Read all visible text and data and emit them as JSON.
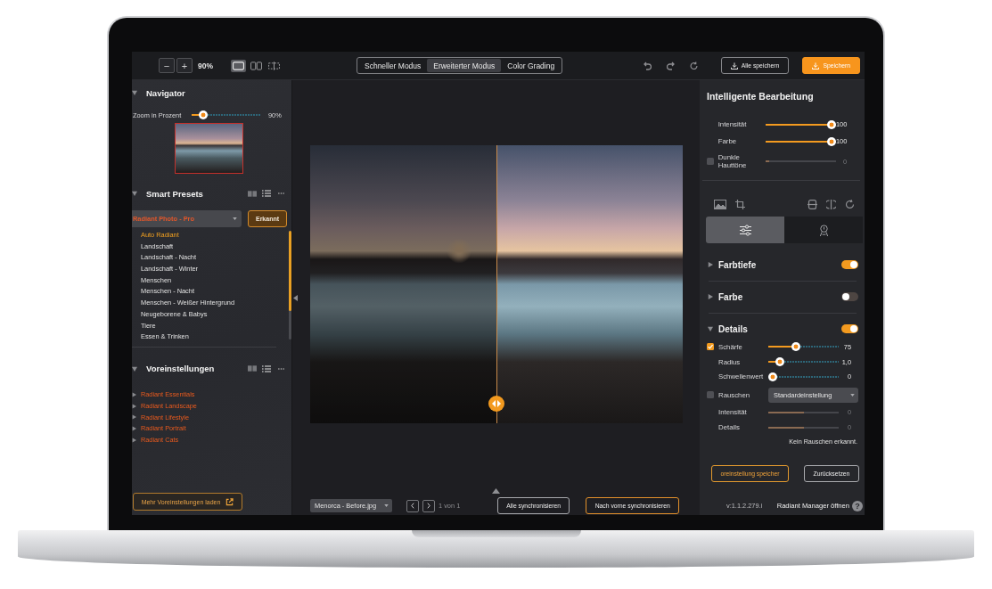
{
  "toolbar": {
    "zoom_out": "−",
    "zoom_in": "+",
    "zoom_value": "90%",
    "view_modes": [
      {
        "kind": "single",
        "selected": true
      },
      {
        "kind": "split",
        "selected": false
      },
      {
        "kind": "compare",
        "selected": false
      }
    ],
    "mode_tabs": [
      {
        "label": "Schneller Modus",
        "selected": false
      },
      {
        "label": "Erweiterter Modus",
        "selected": true
      },
      {
        "label": "Color Grading",
        "selected": false
      }
    ],
    "save_all": "Alle speichern",
    "save": "Speichern"
  },
  "navigator": {
    "title": "Navigator",
    "expanded": true,
    "zoom": {
      "label": "Zoom in Prozent",
      "level": 0.12,
      "reading": "90%"
    }
  },
  "smart_presets": {
    "title": "Smart Presets",
    "expanded": true,
    "profile": "Radiant Photo - Pro",
    "detect_button": "Erkannt",
    "items": [
      {
        "label": "Auto Radiant",
        "selected": true
      },
      {
        "label": "Landschaft",
        "selected": false
      },
      {
        "label": "Landschaft - Nacht",
        "selected": false
      },
      {
        "label": "Landschaft - Winter",
        "selected": false
      },
      {
        "label": "Menschen",
        "selected": false
      },
      {
        "label": "Menschen - Nacht",
        "selected": false
      },
      {
        "label": "Menschen - Weißer Hintergrund",
        "selected": false
      },
      {
        "label": "Neugeborene & Babys",
        "selected": false
      },
      {
        "label": "Tiere",
        "selected": false
      },
      {
        "label": "Essen & Trinken",
        "selected": false
      }
    ]
  },
  "presets": {
    "title": "Voreinstellungen",
    "expanded": true,
    "items": [
      {
        "label": "Radiant Essentials",
        "expanded": false
      },
      {
        "label": "Radiant Landscape",
        "expanded": false
      },
      {
        "label": "Radiant Lifestyle",
        "expanded": false
      },
      {
        "label": "Radiant Portrait",
        "expanded": false
      },
      {
        "label": "Radiant Cats",
        "expanded": false
      }
    ],
    "more_button": "Mehr Voreinstellungen laden"
  },
  "viewer": {
    "file": "Menorca - Before.jpg",
    "page": "1 von 1",
    "sync_all": "Alle synchronisieren",
    "sync_forward": "Nach vorne synchronisieren"
  },
  "smart_edit": {
    "title": "Intelligente Bearbeitung",
    "sliders": [
      {
        "label": "Intensität",
        "level": 1,
        "reading": "100"
      },
      {
        "label": "Farbe",
        "level": 1,
        "reading": "100"
      }
    ],
    "skin_tones": {
      "label": "Dunkle Hauttöne",
      "checked": false,
      "level": 0.05,
      "reading": "0"
    }
  },
  "panel_tabs": [
    {
      "kind": "adjust",
      "selected": true
    },
    {
      "kind": "portrait",
      "selected": false
    }
  ],
  "sections": [
    {
      "title": "Farbtiefe",
      "expanded": false,
      "on": true
    },
    {
      "title": "Farbe",
      "expanded": false,
      "on": false
    },
    {
      "title": "Details",
      "expanded": true,
      "on": true,
      "content": {
        "sharpen": {
          "label": "Schärfe",
          "checked": true,
          "level": 0.38,
          "reading": "75",
          "sliders": [
            {
              "label": "Radius",
              "level": 0.12,
              "reading": "1,0"
            },
            {
              "label": "Schwellenwert",
              "level": 0,
              "reading": "0"
            }
          ]
        },
        "noise": {
          "label": "Rauschen",
          "checked": false,
          "preset": "Standardeinstellung",
          "sliders": [
            {
              "label": "Intensität",
              "level": 0.5,
              "reading": "0"
            },
            {
              "label": "Details",
              "level": 0.5,
              "reading": "0"
            }
          ],
          "note": "Kein Rauschen erkannt."
        }
      }
    }
  ],
  "actions": {
    "save_preset": "oreinstellung speicher",
    "reset": "Zurücksetzen"
  },
  "footer": {
    "version": "v:1.1.2.279.i",
    "manager_link": "Radiant Manager öffnen",
    "help": "?"
  }
}
